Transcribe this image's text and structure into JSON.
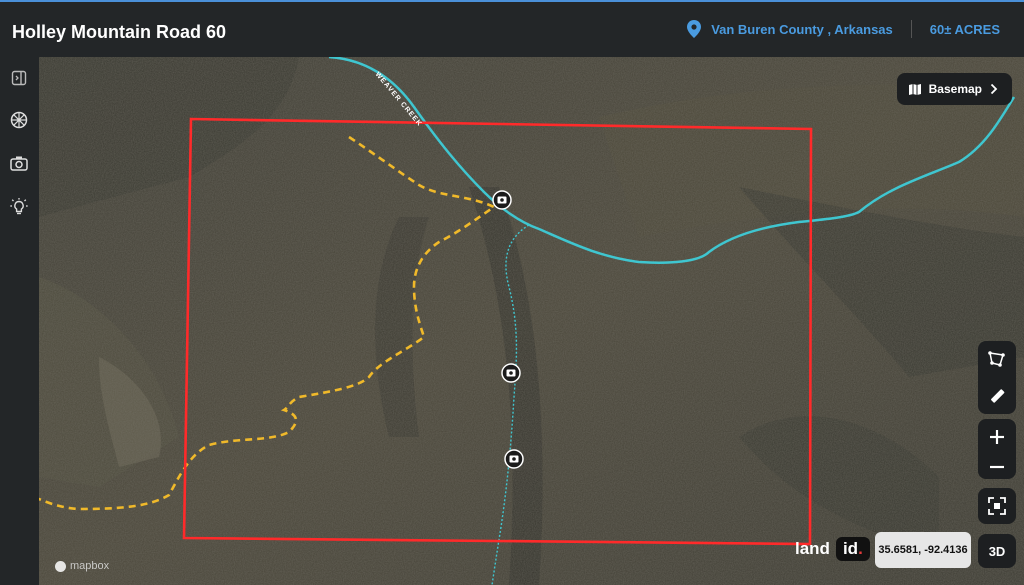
{
  "header": {
    "title": "Holley Mountain Road 60",
    "location": "Van Buren County , Arkansas",
    "acreage": "60± ACRES"
  },
  "sidebar": {
    "items": [
      {
        "icon": "panel-collapse-icon"
      },
      {
        "icon": "compass-wheel-icon"
      },
      {
        "icon": "camera-icon"
      },
      {
        "icon": "lightbulb-icon"
      }
    ]
  },
  "map": {
    "basemap_label": "Basemap",
    "creek_label": "WEAVER CREEK",
    "coordinates": "35.6581, -92.4136",
    "view_toggle": "3D",
    "brand": {
      "part1": "land",
      "part2": "id",
      "dot": "."
    },
    "attribution": "mapbox",
    "colors": {
      "boundary": "#ff2a2a",
      "trail": "#f0b92a",
      "creek": "#3fc6d0",
      "accent": "#4a9be0"
    }
  }
}
